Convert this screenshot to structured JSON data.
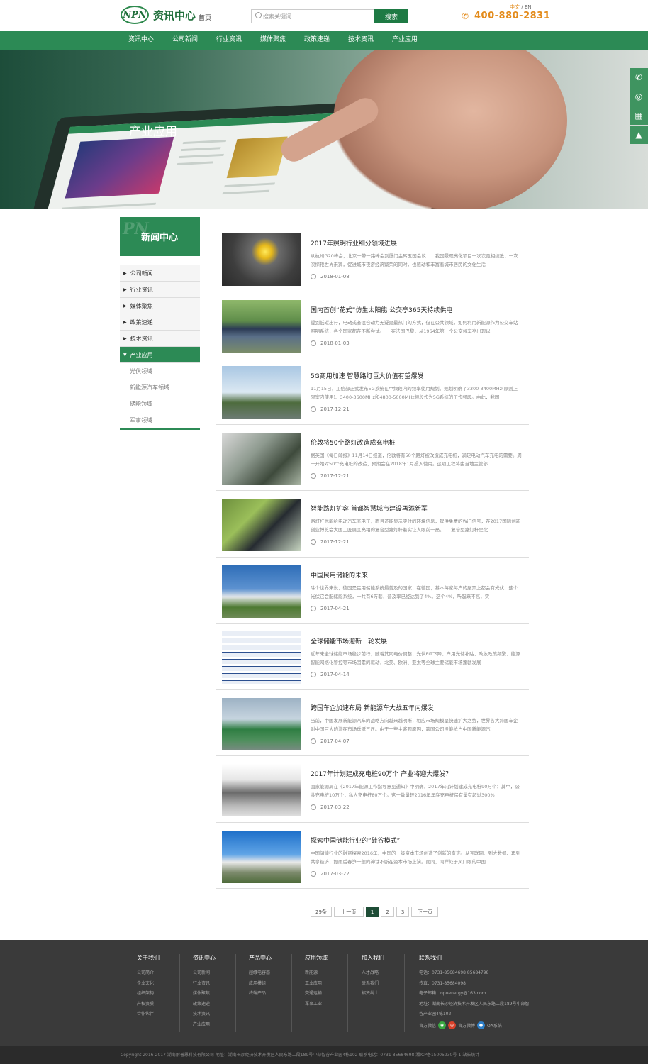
{
  "header": {
    "logo_mark": "NPN",
    "logo_text": "资讯中心",
    "home": "首页",
    "search_placeholder": "搜索关键词",
    "search_button": "搜索",
    "lang_cn": "中文",
    "lang_sep": " / ",
    "lang_en": "EN",
    "phone": "400-880-2831"
  },
  "nav": [
    "资讯中心",
    "公司新闻",
    "行业资讯",
    "媒体聚焦",
    "政策速递",
    "技术资讯",
    "产业应用"
  ],
  "banner": {
    "title": "产业应用"
  },
  "sidebar": {
    "title": "新闻中心",
    "items": [
      "公司新闻",
      "行业资讯",
      "媒体聚焦",
      "政策速递",
      "技术资讯",
      "产业应用"
    ],
    "active": "产业应用",
    "subitems": [
      "光伏领域",
      "新能源汽车领域",
      "储能领域",
      "军事领域"
    ]
  },
  "news": [
    {
      "title": "2017年照明行业细分领域进展",
      "desc": "从杭州G20峰会，北京一带一路峰会到厦门金砖五国会议……我国景观亮化项目一次次竞相绽放，一次次惊艳世界来宾，促进城市夜游经济繁荣的同时，也感动和丰富着城市居民的文化生活",
      "date": "2018-01-08"
    },
    {
      "title": "国内首创“花式”仿生太阳能 公交亭365天持续供电",
      "desc": "提到低碳出行，电动或者混合动力无疑是最热门的方式，但在公共领域，如何利用新能源作为公交车站照明系统，各个国家都在不断尝试。　　在法国巴黎，从1964年第一个公交候车亭出现以",
      "date": "2018-01-03"
    },
    {
      "title": "5G商用加速 智慧路灯巨大价值有望爆发",
      "desc": "11月15日，工信部正式发布5G系统在中频段内的频率使用规划。规划明确了3300-3400MHz(原则上限室内使用)、3400-3600MHz和4800-5000MHz频段作为5G系统的工作频段。由此，我国",
      "date": "2017-12-21"
    },
    {
      "title": "伦敦将50个路灯改造成充电桩",
      "desc": "据英国《每日邮报》11月14日报道，伦敦将有50个路灯被改造成充电桩，满足电动汽车充电的需要。周一开始对50个充电桩的改造，预期会在2018年1月投入使用。这项工程将由当地主管部",
      "date": "2017-12-21"
    },
    {
      "title": "智能路灯扩容 首都智慧城市建设再添新军",
      "desc": "路灯杆也能给电动汽车充电了，而且还能显示实时的环境信息，提供免费的WiFi信号，在2017国际创新创业博览会大国工匠展区亮相的复合型路灯杆着实让人眼前一亮。　　复合型路灯杆是北",
      "date": "2017-12-21"
    },
    {
      "title": "中国民用储能的未来",
      "desc": "除个世界来说，德国是民用储能系统最普及的国家，在德国，基本每家每户的屋顶上都会有光伏，这个光伏它会配储能系统，一共有6万套，普及率已经达到了4%。这个4%，听起来不高，实",
      "date": "2017-04-21"
    },
    {
      "title": "全球储能市场迎新一轮发展",
      "desc": "近年来全球储能市场稳步前行，随着其同电价调整、光伏FIT下降、户用光储补贴、政收政策频繁、能源智能网络化管控等市场因素的驱动，北美、欧洲、亚太等全球主要储能市场蓬勃发展",
      "date": "2017-04-14"
    },
    {
      "title": "跨国车企加速布局 新能源车大战五年内爆发",
      "desc": "当前，中国发展新能源汽车的战略方向越来越明晰，相应市场规模呈快速扩大之势，世界各大跨国车企对中国巨大的潜在市场垂涎三尺。由于一些主客观原因，跨国公司没能抢占中国新能源汽",
      "date": "2017-04-07"
    },
    {
      "title": "2017年计划建成充电桩90万个 产业将迎大爆发？",
      "desc": "国家能源局在《2017年能源工作指导意见通知》中明确，2017年内计划建成充电桩90万个；其中，公共充电桩10万个，私人充电桩80万个。这一数量较2016年年底充电桩保有量有超过300%",
      "date": "2017-03-22"
    },
    {
      "title": "探索中国储能行业的“硅谷模式”",
      "desc": "中国储能行业的融资探索2016年，中国的一级资本市场创造了创新的奇迹。从互联网、到大数据、再到共享经济，如雨后春笋一般的神话不断在资本市场上演。而同，同样处于风口眼的中国",
      "date": "2017-03-22"
    }
  ],
  "pager": {
    "total": "29条",
    "prev": "上一页",
    "pages": [
      "1",
      "2",
      "3"
    ],
    "current": "1",
    "next": "下一页"
  },
  "footer": {
    "cols": [
      {
        "title": "关于我们",
        "links": [
          "公司简介",
          "企业文化",
          "组织架构",
          "产权资质",
          "合作伙伴"
        ]
      },
      {
        "title": "资讯中心",
        "links": [
          "公司新闻",
          "行业资讯",
          "媒体聚焦",
          "政策速递",
          "技术资讯",
          "产业应用"
        ]
      },
      {
        "title": "产品中心",
        "links": [
          "超级电容器",
          "应用模组",
          "终端产品"
        ]
      },
      {
        "title": "应用领域",
        "links": [
          "新能源",
          "工业应用",
          "交通运输",
          "军事工业"
        ]
      },
      {
        "title": "加入我们",
        "links": [
          "人才战略",
          "联系我们",
          "招贤纳士"
        ]
      }
    ],
    "contact": {
      "title": "联系我们",
      "lines": [
        "电话：0731-85684698 85684798",
        "传真：0731-85684098",
        "电子邮箱：npuenergy@163.com",
        "地址：湖南长沙经济技术开发区人民东路二段189号中部智谷产业园4栋102"
      ],
      "social": [
        {
          "label": "官方微信",
          "icon": "wechat-icon",
          "color": "#3aa842"
        },
        {
          "label": "官方微博",
          "icon": "weibo-icon",
          "color": "#d9412a"
        },
        {
          "label": "OA系统",
          "icon": "user-icon",
          "color": "#2e7fc8"
        }
      ]
    },
    "copyright": "Copyright 2016-2017 湖南耐普恩科技有限公司 地址：湖南长沙经济技术开发区人民东路二段189号中部智谷产业园4栋102 联系电话：0731-85684698 湘ICP备15005930号-1 站长统计"
  }
}
